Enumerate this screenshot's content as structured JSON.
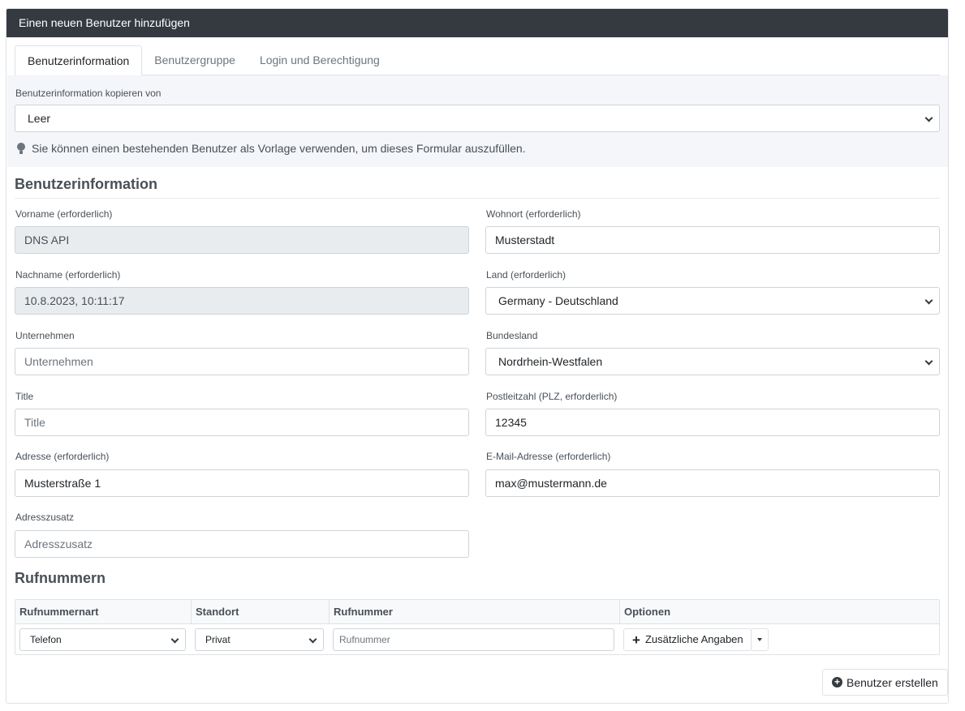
{
  "header": {
    "title": "Einen neuen Benutzer hinzufügen"
  },
  "tabs": [
    {
      "label": "Benutzerinformation",
      "active": true
    },
    {
      "label": "Benutzergruppe",
      "active": false
    },
    {
      "label": "Login und Berechtigung",
      "active": false
    }
  ],
  "copy": {
    "label": "Benutzerinformation kopieren von",
    "value": "Leer",
    "hint": "Sie können einen bestehenden Benutzer als Vorlage verwenden, um dieses Formular auszufüllen."
  },
  "section_title": "Benutzerinformation",
  "fields": {
    "vorname": {
      "label": "Vorname (erforderlich)",
      "value": "DNS API"
    },
    "nachname": {
      "label": "Nachname (erforderlich)",
      "value": "10.8.2023, 10:11:17"
    },
    "unternehmen": {
      "label": "Unternehmen",
      "placeholder": "Unternehmen"
    },
    "title": {
      "label": "Title",
      "placeholder": "Title"
    },
    "adresse": {
      "label": "Adresse (erforderlich)",
      "value": "Musterstraße 1"
    },
    "adresszusatz": {
      "label": "Adresszusatz",
      "placeholder": "Adresszusatz"
    },
    "wohnort": {
      "label": "Wohnort (erforderlich)",
      "value": "Musterstadt"
    },
    "land": {
      "label": "Land (erforderlich)",
      "value": "Germany - Deutschland"
    },
    "bundesland": {
      "label": "Bundesland",
      "value": "Nordrhein-Westfalen"
    },
    "plz": {
      "label": "Postleitzahl (PLZ, erforderlich)",
      "value": "12345"
    },
    "email": {
      "label": "E-Mail-Adresse (erforderlich)",
      "value": "max@mustermann.de"
    }
  },
  "phones": {
    "title": "Rufnummern",
    "columns": [
      "Rufnummernart",
      "Standort",
      "Rufnummer",
      "Optionen"
    ],
    "row": {
      "type": "Telefon",
      "location": "Privat",
      "number_placeholder": "Rufnummer",
      "extra_button": "Zusätzliche Angaben"
    }
  },
  "submit_label": "Benutzer erstellen"
}
